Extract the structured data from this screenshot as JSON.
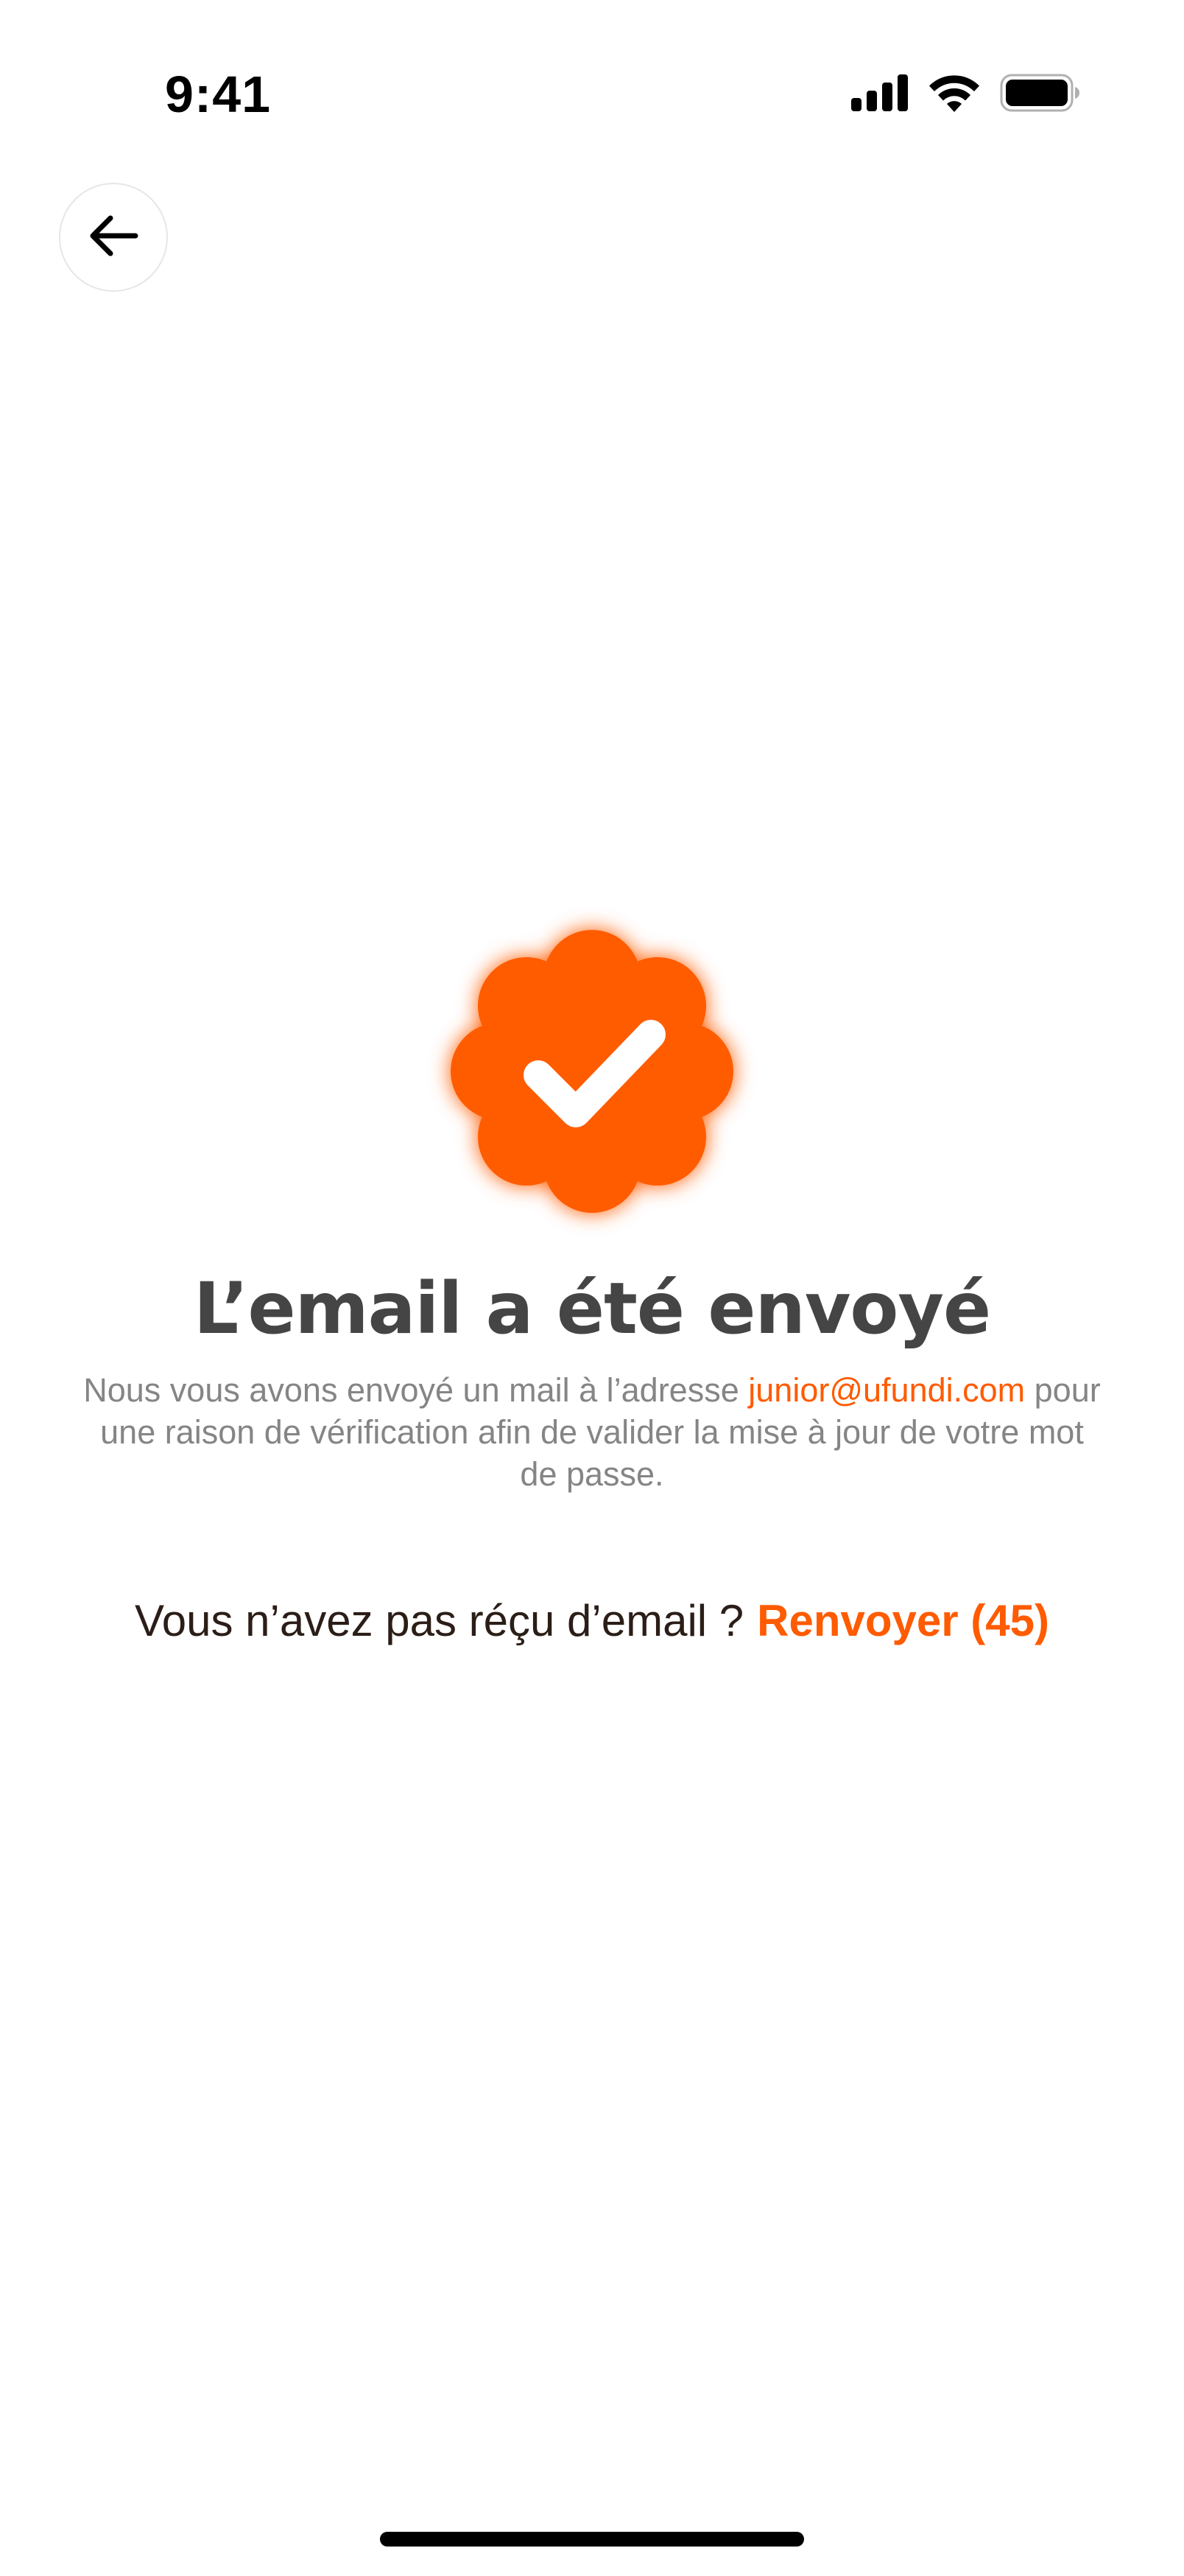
{
  "status_bar": {
    "time": "9:41",
    "icons": [
      "cellular-signal-icon",
      "wifi-icon",
      "battery-icon"
    ]
  },
  "navigation": {
    "back_icon": "arrow-left-icon"
  },
  "badge": {
    "icon": "verified-check-badge-icon",
    "color": "#ff5b00"
  },
  "content": {
    "title": "L’email a été envoyé",
    "description_before": "Nous vous avons envoyé un mail à l’adresse",
    "email": "junior@ufundi.com",
    "description_after": "pour une raison de vérification afin de valider la mise à jour de votre mot de passe."
  },
  "resend": {
    "prompt": "Vous n’avez pas réçu d’email ?",
    "link_label": "Renvoyer (45)"
  },
  "colors": {
    "accent": "#ff5b00",
    "title": "#454545",
    "body": "#858585"
  }
}
